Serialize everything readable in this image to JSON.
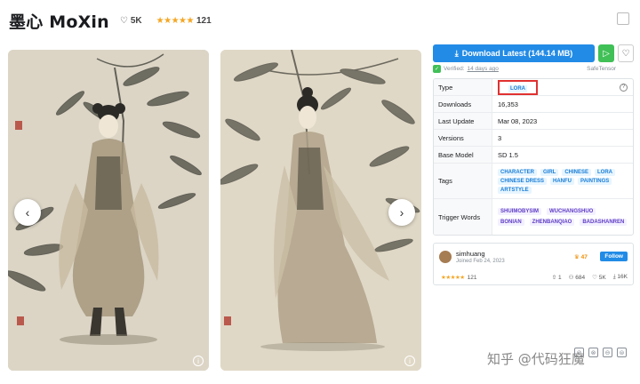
{
  "header": {
    "title": "墨心 MoXin",
    "likes": "5K",
    "rating_count": "121"
  },
  "gallery": {
    "prev_arrow": "‹",
    "next_arrow": "›"
  },
  "download": {
    "label": "Download Latest (144.14 MB)",
    "verified_label": "Verified:",
    "verified_ago": "14 days ago",
    "safetensor": "SafeTensor"
  },
  "details": {
    "type_label": "Type",
    "type_value": "LORA",
    "downloads_label": "Downloads",
    "downloads_value": "16,353",
    "last_update_label": "Last Update",
    "last_update_value": "Mar 08, 2023",
    "versions_label": "Versions",
    "versions_value": "3",
    "base_model_label": "Base Model",
    "base_model_value": "SD 1.5",
    "tags_label": "Tags",
    "tags": [
      "CHARACTER",
      "GIRL",
      "CHINESE",
      "LORA",
      "CHINESE DRESS",
      "HANFU",
      "PAINTINGS",
      "ARTSTYLE"
    ],
    "trigger_label": "Trigger Words",
    "triggers": [
      "SHUIMOBYSIM",
      "WUCHANGSHUO",
      "BONIAN",
      "ZHENBANQIAO",
      "BADASHANREN"
    ]
  },
  "creator": {
    "name": "simhuang",
    "joined": "Joined Feb 24, 2023",
    "rank": "47",
    "follow_label": "Follow",
    "rating_count": "121",
    "uploads": "1",
    "followers": "684",
    "favorites": "5K",
    "downloads": "16K"
  },
  "watermark": "知乎 @代码狂魔",
  "colors": {
    "accent": "#228be6",
    "green": "#40c057",
    "highlight_box": "#e03131",
    "star": "#f5a623"
  }
}
